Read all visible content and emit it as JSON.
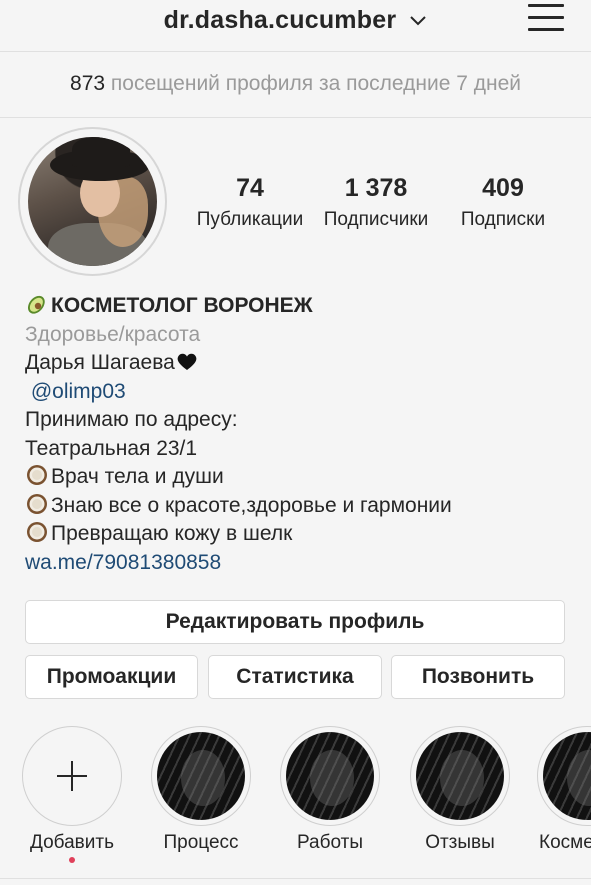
{
  "header": {
    "username": "dr.dasha.cucumber"
  },
  "visits": {
    "count": "873",
    "text": "посещений профиля за последние 7 дней"
  },
  "stats": {
    "posts": {
      "value": "74",
      "label": "Публикации"
    },
    "followers": {
      "value": "1 378",
      "label": "Подписчики"
    },
    "following": {
      "value": "409",
      "label": "Подписки"
    }
  },
  "bio": {
    "name": "КОСМЕТОЛОГ ВОРОНЕЖ",
    "category": "Здоровье/красота",
    "full_name": "Дарья Шагаева",
    "mention": "@olimp03",
    "line1": "Принимаю по адресу:",
    "line2": "Театральная 23/1",
    "line3": "Врач тела и души",
    "line4": "Знаю все о красоте,здоровье и гармонии",
    "line5": "Превращаю кожу в шелк",
    "website": "wa.me/79081380858"
  },
  "buttons": {
    "edit_profile": "Редактировать профиль",
    "promotions": "Промоакции",
    "statistics": "Статистика",
    "call": "Позвонить"
  },
  "highlights": [
    {
      "label": "Добавить"
    },
    {
      "label": "Процесс"
    },
    {
      "label": "Работы"
    },
    {
      "label": "Отзывы"
    },
    {
      "label": "Косме"
    }
  ],
  "icons": {
    "menu": "hamburger-menu-icon",
    "dropdown": "chevron-down-icon",
    "avocado": "avocado-emoji",
    "heart": "black-heart-emoji",
    "coconut": "coconut-emoji"
  }
}
